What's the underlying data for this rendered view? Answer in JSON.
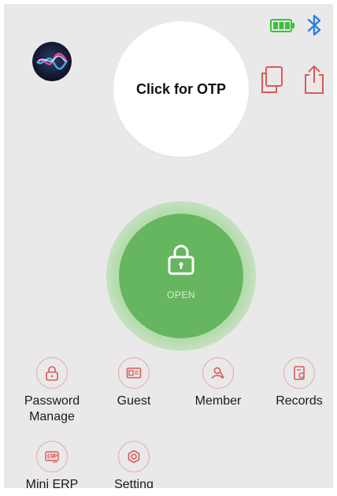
{
  "colors": {
    "screen_background": "#e9e9e9",
    "accent_red": "#d95a5a",
    "menu_circle_border": "#e8a9a9",
    "open_green": "#66b55f",
    "battery_green": "#3cc13b",
    "bluetooth_blue": "#2f7de1"
  },
  "status_bar": {
    "battery_icon": "battery-full-icon",
    "bluetooth_icon": "bluetooth-icon"
  },
  "top": {
    "siri_icon": "siri-icon",
    "otp_button_label": "Click for OTP",
    "copy_icon": "copy-icon",
    "share_icon": "share-icon"
  },
  "open_button": {
    "label": "OPEN",
    "icon": "lock-icon"
  },
  "menu": {
    "items": [
      {
        "label": "Password\nManage",
        "icon": "password-lock-icon"
      },
      {
        "label": "Guest",
        "icon": "guest-id-card-icon"
      },
      {
        "label": "Member",
        "icon": "member-user-icon"
      },
      {
        "label": "Records",
        "icon": "records-document-icon"
      },
      {
        "label": "Mini ERP",
        "icon": "erp-icon"
      },
      {
        "label": "Setting",
        "icon": "settings-gear-icon"
      }
    ]
  }
}
